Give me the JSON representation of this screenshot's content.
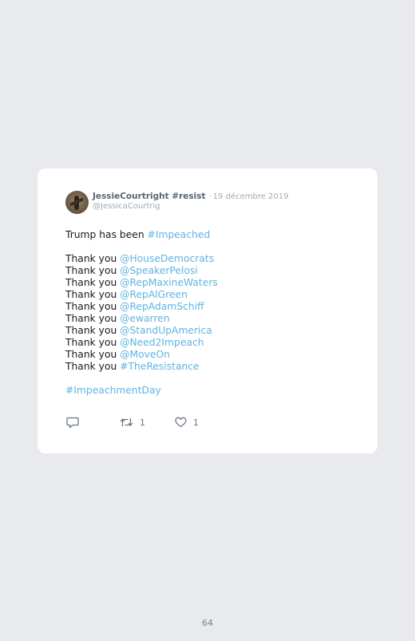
{
  "tweet": {
    "display_name": "JessieCourtright #resist",
    "separator": "·",
    "date": "19 décembre 2019",
    "handle": "@JessicaCourtrig",
    "lines": [
      {
        "prefix": "Trump has been ",
        "link": "#Impeached"
      },
      {
        "prefix": "Thank you ",
        "link": "@HouseDemocrats"
      },
      {
        "prefix": "Thank you ",
        "link": "@SpeakerPelosi"
      },
      {
        "prefix": "Thank you ",
        "link": "@RepMaxineWaters"
      },
      {
        "prefix": "Thank you ",
        "link": "@RepAlGreen"
      },
      {
        "prefix": "Thank you ",
        "link": "@RepAdamSchiff"
      },
      {
        "prefix": "Thank you ",
        "link": "@ewarren"
      },
      {
        "prefix": "Thank you ",
        "link": "@StandUpAmerica"
      },
      {
        "prefix": "Thank you ",
        "link": "@Need2Impeach"
      },
      {
        "prefix": "Thank you ",
        "link": "@MoveOn"
      },
      {
        "prefix": "Thank you ",
        "link": "#TheResistance"
      },
      {
        "prefix": "",
        "link": "#ImpeachmentDay"
      }
    ],
    "retweet_count": "1",
    "like_count": "1"
  },
  "page_number": "64",
  "colors": {
    "link": "#5eb4e2",
    "background": "#e8eaee",
    "card": "#ffffff",
    "icon": "#6b7584"
  },
  "icons": [
    "avatar",
    "reply-icon",
    "retweet-icon",
    "like-icon"
  ]
}
